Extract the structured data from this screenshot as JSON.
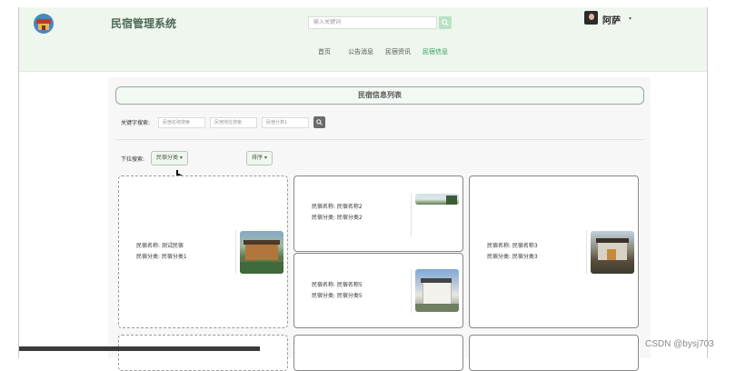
{
  "header": {
    "app_title": "民宿管理系统",
    "search_placeholder": "输入关键词",
    "nav": [
      "首页",
      "公告消息",
      "民宿资讯",
      "民宿信息"
    ],
    "active_nav": "民宿信息",
    "user_name": "阿萨",
    "user_caret": "▾"
  },
  "main": {
    "panel_title": "民宿信息列表",
    "keyword_label": "关键字搜索:",
    "keyword_inputs": [
      "民宿名称搜索",
      "民宿地址搜索",
      "民宿分类1"
    ],
    "dropdown_label": "下拉搜索:",
    "dropdown_category": "民宿分类 ▾",
    "dropdown_sort": "排序 ▾"
  },
  "cards": [
    {
      "name_label": "民宿名称: 测试民宿",
      "category_label": "民宿分类: 民宿分类1"
    },
    {
      "name_label": "民宿名称: 民宿名称2",
      "category_label": "民宿分类: 民宿分类2"
    },
    {
      "name_label": "民宿名称: 民宿名称3",
      "category_label": "民宿分类: 民宿分类3"
    },
    {
      "name_label": "民宿名称: 民宿名称5",
      "category_label": "民宿分类: 民宿分类5"
    }
  ],
  "watermark": "CSDN @bysj703",
  "colors": {
    "header_bg": "#eef6ee",
    "accent_green": "#2e9e5e",
    "title_text": "#4d6b58"
  }
}
